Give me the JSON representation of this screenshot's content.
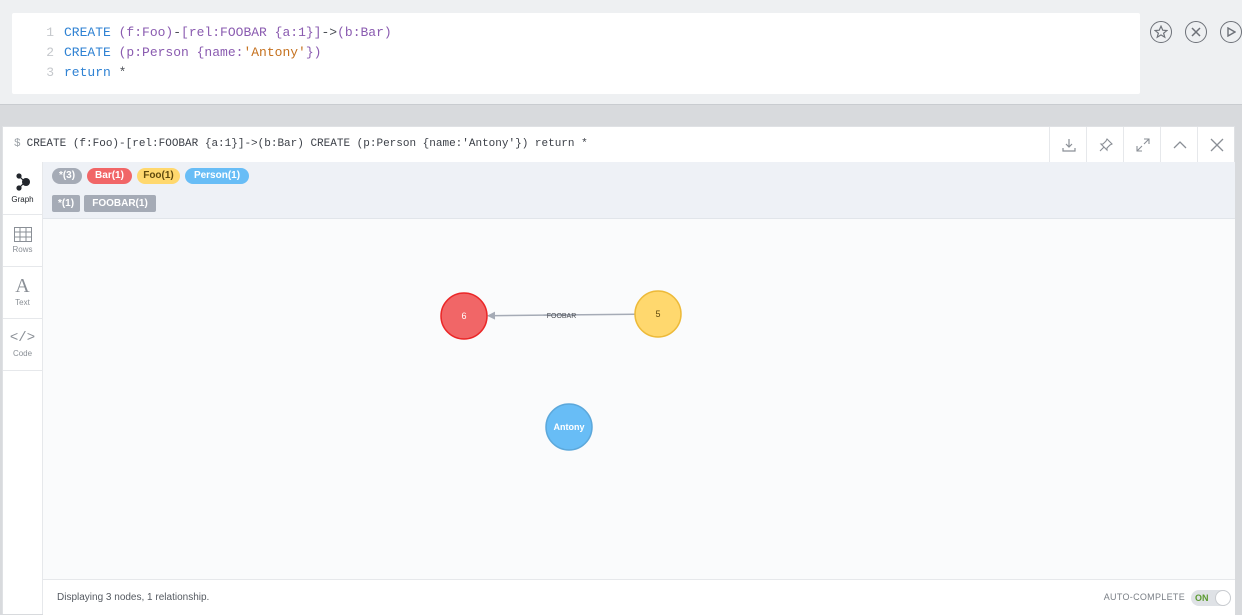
{
  "editor": {
    "lines": [
      {
        "num": "1",
        "tokens": [
          {
            "t": "CREATE",
            "c": "kw"
          },
          {
            "t": " (f:Foo)",
            "c": "pu"
          },
          {
            "t": "-",
            "c": "op"
          },
          {
            "t": "[rel:FOOBAR {a:1}]",
            "c": "pu"
          },
          {
            "t": "->",
            "c": "op"
          },
          {
            "t": "(b:Bar)",
            "c": "pu"
          }
        ]
      },
      {
        "num": "2",
        "tokens": [
          {
            "t": "CREATE",
            "c": "kw"
          },
          {
            "t": " (p:Person {name:",
            "c": "pu"
          },
          {
            "t": "'Antony'",
            "c": "st"
          },
          {
            "t": "})",
            "c": "pu"
          }
        ]
      },
      {
        "num": "3",
        "tokens": [
          {
            "t": "return",
            "c": "kw"
          },
          {
            "t": " *",
            "c": "op"
          }
        ]
      }
    ]
  },
  "frame": {
    "prompt": "$",
    "query": "CREATE (f:Foo)-[rel:FOOBAR {a:1}]->(b:Bar) CREATE (p:Person {name:'Antony'}) return *"
  },
  "sidebar": {
    "graph": "Graph",
    "rows": "Rows",
    "text": "Text",
    "text_glyph": "A",
    "code": "Code",
    "code_glyph": "</>"
  },
  "legend": {
    "labels": [
      {
        "text": "*(3)",
        "color": "#a5abb6"
      },
      {
        "text": "Bar(1)",
        "color": "#f16667"
      },
      {
        "text": "Foo(1)",
        "color": "#ffd86e",
        "textColor": "#604a0e"
      },
      {
        "text": "Person(1)",
        "color": "#68bdf6"
      }
    ],
    "relationships": [
      "*(1)",
      "FOOBAR(1)"
    ]
  },
  "graph": {
    "nodes": [
      {
        "id": "bar",
        "caption": "6",
        "color": "#f16667",
        "border": "#eb2728",
        "textColor": "#ffffff"
      },
      {
        "id": "foo",
        "caption": "5",
        "color": "#ffd86e",
        "border": "#edba39",
        "textColor": "#604a0e"
      },
      {
        "id": "person",
        "caption": "Antony",
        "color": "#68bdf6",
        "border": "#5ca8db",
        "textColor": "#ffffff"
      }
    ],
    "relationship": {
      "from": "foo",
      "to": "bar",
      "type": "FOOBAR",
      "color": "#a5abb6"
    }
  },
  "status": {
    "text": "Displaying 3 nodes, 1 relationship.",
    "autocomplete_label": "AUTO-COMPLETE",
    "toggle": "ON"
  }
}
